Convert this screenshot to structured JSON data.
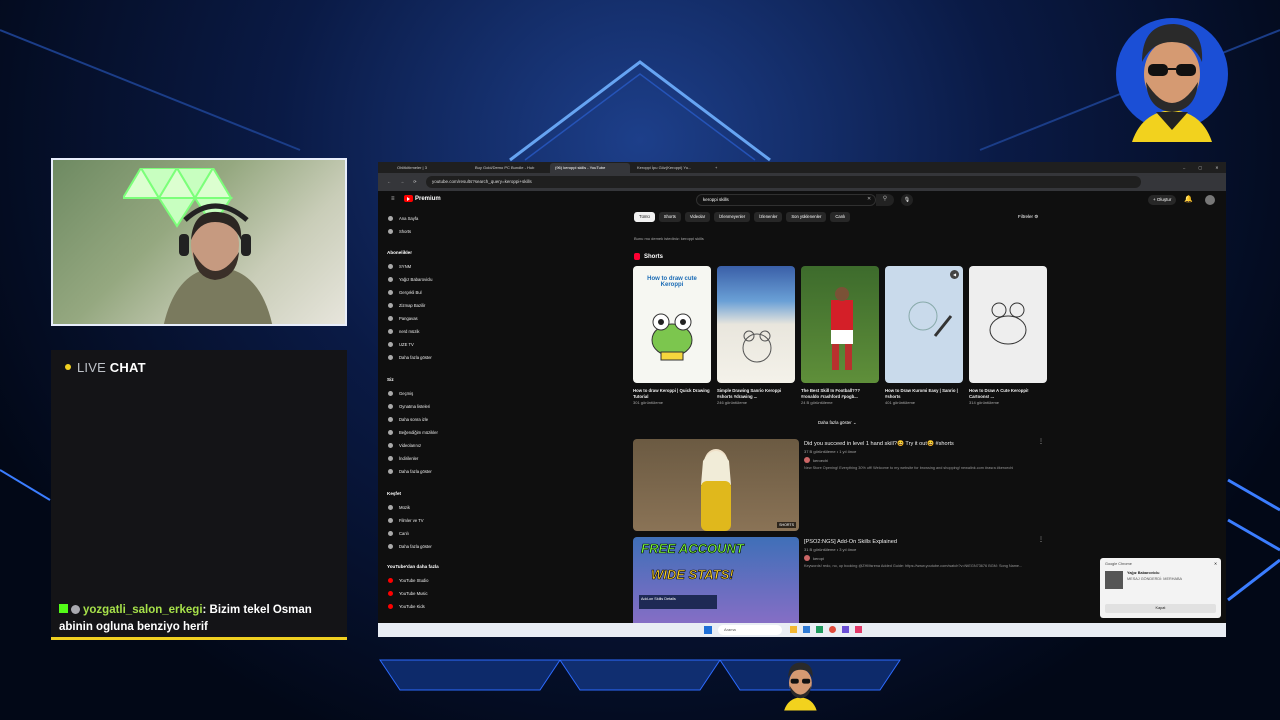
{
  "chat": {
    "header_live": "LIVE",
    "header_chat": "CHAT",
    "message_user": "yozgatli_salon_erkegi",
    "message_text": ": Bizim tekel Osman abinin ogluna benziyo herif"
  },
  "browser": {
    "tabs": [
      "Ohlitkitirmeler | 3",
      "Buy Gold/Demo PC Bundle - Hub",
      "(96) keroppi skills - YouTube",
      "Keroppi İpu Göz(Keroppi) Yu..."
    ],
    "url": "youtube.com/results?search_query=keroppi+skills"
  },
  "youtube": {
    "logo": "Premium",
    "search_query": "keroppi skills",
    "create_label": "Oluştur",
    "bell_count": "9+",
    "chips": [
      "Tümü",
      "Shorts",
      "Videolar",
      "İzlenmeyenler",
      "İzlenenler",
      "Son yüklenenler",
      "Canlı"
    ],
    "filters_label": "Filtreler",
    "note": "Bunu mu demek istediniz: keroppi skills",
    "shorts_title": "Shorts",
    "shorts": [
      {
        "title": "How to draw Keroppi | Quick Drawing Tutorial",
        "views": "301 görüntüleme",
        "thumb_text": "How to draw cute Keroppi"
      },
      {
        "title": "Simple Drawing Sanrio Keroppi #shorts #drawing ...",
        "views": "246 görüntüleme"
      },
      {
        "title": "The Best Skill In Football??? #ronaldo #rashford #pogb...",
        "views": "24 B görüntüleme"
      },
      {
        "title": "How to Draw Kuromi Easy | Sanrio | #shorts",
        "views": "401 görüntüleme"
      },
      {
        "title": "How to Draw A Cute Keroppi! Cartoons! ...",
        "views": "314 görüntüleme"
      }
    ],
    "more_label": "Daha fazla göster",
    "videos": [
      {
        "title": "Did you succeed in level 1 hand skill?😆 Try it out😆 #shorts",
        "stats": "37 B görüntüleme • 1 yıl önce",
        "channel": "keroechi",
        "desc": "New Store Opening! Everything 30% off! Welcome to my website for browsing and shopping! newalink.com #rasra #keroechi",
        "badge": "SHORTS"
      },
      {
        "title": "[PSO2:NGS] Add-On Skills Explained",
        "stats": "31 B görüntüleme • 3 yıl önce",
        "channel": "keropi",
        "desc": "Keywords! redo, no, up booking @ZHMsrena Added Guide: https://www.youtube.com/watch?v=NtEGN73676 BGM: Song Name...",
        "thumb_line1": "FREE ACCOUNT",
        "thumb_line2": "WIDE STATS!",
        "thumb_sub": "Add-on Skills Details"
      }
    ],
    "sidebar": {
      "top": [
        "Ana Sayfa",
        "Shorts"
      ],
      "subs_title": "Abonelikler",
      "subs": [
        "SYNM",
        "Yağız Babaroviclu",
        "Gerçekli Bul",
        "Zizmap Bazilir",
        "Pangavas",
        "nerd müzik",
        "UZE TV",
        "Daha fazla göster"
      ],
      "you_title": "Siz",
      "you": [
        "Geçmiş",
        "Oynatma listeleri",
        "Daha sonra izle",
        "Beğendiğim müzikler",
        "Videolarınız",
        "İndirilenler",
        "Daha fazla göster"
      ],
      "explore_title": "Keşfet",
      "explore": [
        "Müzik",
        "Filmler ve TV",
        "Canlı",
        "Daha fazla göster"
      ],
      "more_title": "YouTube'dan daha fazla",
      "more": [
        "YouTube Studio",
        "YouTube Music",
        "YouTube Kids"
      ]
    },
    "toast": {
      "header": "Google Chrome",
      "name": "Yağız Babaroviclu",
      "message": "MESAJ GÖNDERDİ: MERHABA",
      "button": "Kapat"
    }
  },
  "taskbar": {
    "search": "Arama"
  }
}
